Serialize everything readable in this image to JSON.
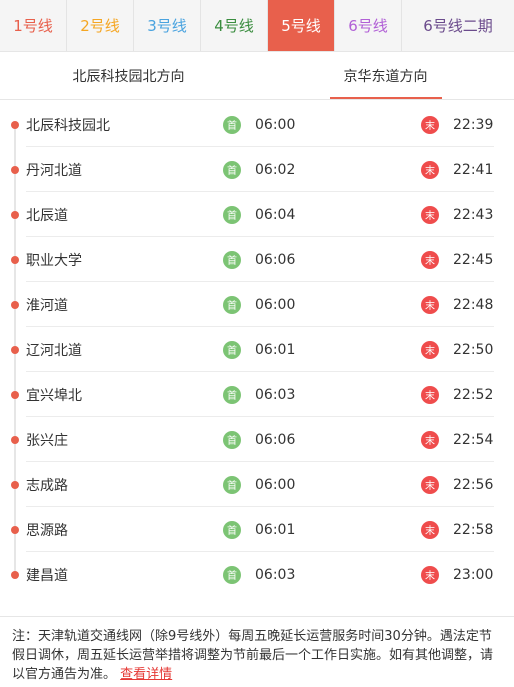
{
  "colors": {
    "active_tab_bg": "#e8604c",
    "first_badge": "#7cc474",
    "last_badge": "#ef4c4c"
  },
  "line_tabs": [
    {
      "label": "1号线",
      "color": "#e8604c"
    },
    {
      "label": "2号线",
      "color": "#f5a623"
    },
    {
      "label": "3号线",
      "color": "#4aa3df"
    },
    {
      "label": "4号线",
      "color": "#3a8d3f"
    },
    {
      "label": "5号线",
      "color": "#ffffff",
      "active": true
    },
    {
      "label": "6号线",
      "color": "#b160d6"
    },
    {
      "label": "6号线二期",
      "color": "#6b4b8c"
    }
  ],
  "direction_tabs": [
    {
      "label": "北辰科技园北方向"
    },
    {
      "label": "京华东道方向",
      "active": true
    }
  ],
  "badges": {
    "first": "首",
    "last": "末"
  },
  "stations": [
    {
      "name": "北辰科技园北",
      "first": "06:00",
      "last": "22:39"
    },
    {
      "name": "丹河北道",
      "first": "06:02",
      "last": "22:41"
    },
    {
      "name": "北辰道",
      "first": "06:04",
      "last": "22:43"
    },
    {
      "name": "职业大学",
      "first": "06:06",
      "last": "22:45"
    },
    {
      "name": "淮河道",
      "first": "06:00",
      "last": "22:48"
    },
    {
      "name": "辽河北道",
      "first": "06:01",
      "last": "22:50"
    },
    {
      "name": "宜兴埠北",
      "first": "06:03",
      "last": "22:52"
    },
    {
      "name": "张兴庄",
      "first": "06:06",
      "last": "22:54"
    },
    {
      "name": "志成路",
      "first": "06:00",
      "last": "22:56"
    },
    {
      "name": "思源路",
      "first": "06:01",
      "last": "22:58"
    },
    {
      "name": "建昌道",
      "first": "06:03",
      "last": "23:00"
    }
  ],
  "note": {
    "text": "注：天津轨道交通线网（除9号线外）每周五晚延长运营服务时间30分钟。遇法定节假日调休，周五延长运营举措将调整为节前最后一个工作日实施。如有其他调整，请以官方通告为准。",
    "link": "查看详情"
  }
}
